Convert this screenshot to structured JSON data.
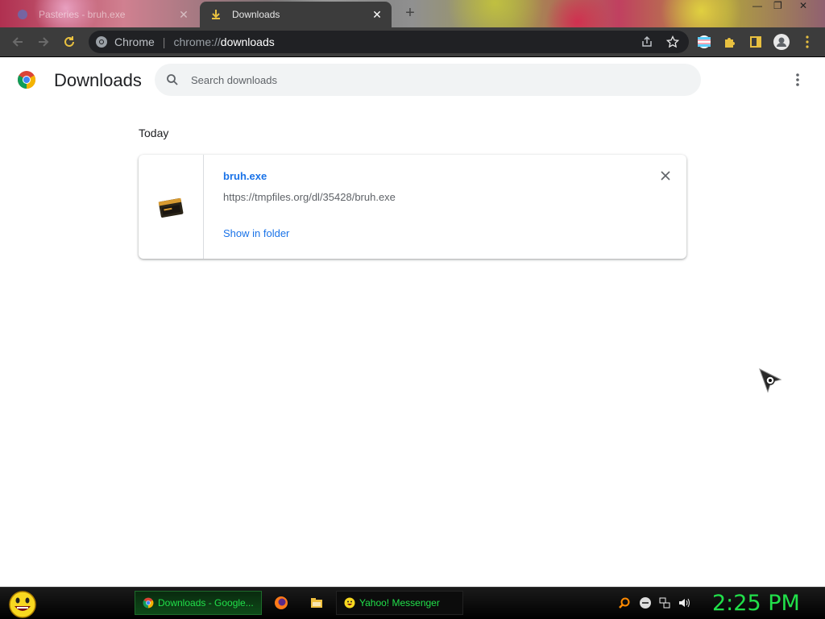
{
  "tabs": [
    {
      "title": "Pasteries - bruh.exe",
      "active": false
    },
    {
      "title": "Downloads",
      "active": true
    }
  ],
  "toolbar": {
    "site_name": "Chrome",
    "url_scheme": "chrome://",
    "url_host": "downloads"
  },
  "page": {
    "title": "Downloads",
    "search_placeholder": "Search downloads",
    "section_label": "Today"
  },
  "download": {
    "file_name": "bruh.exe",
    "source_url": "https://tmpfiles.org/dl/35428/bruh.exe",
    "show_in_folder": "Show in folder"
  },
  "taskbar": {
    "tasks": [
      {
        "label": "Downloads - Google...",
        "icon": "chrome-icon"
      },
      {
        "label": "Yahoo! Messenger",
        "icon": "yahoo-messenger-icon"
      }
    ],
    "clock": "2:25 PM"
  },
  "colors": {
    "accent_link": "#1a73e8",
    "toolbar_bg": "#3c3c3c",
    "taskbar_text": "#21e04a"
  }
}
